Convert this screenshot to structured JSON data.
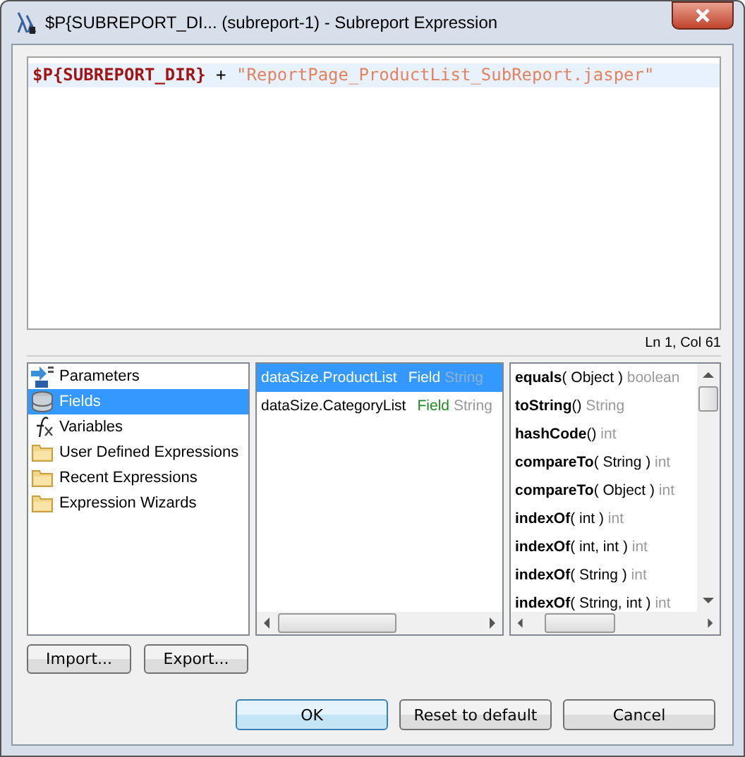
{
  "window": {
    "title": "$P{SUBREPORT_DI... (subreport-1) - Subreport Expression"
  },
  "editor": {
    "tokens": [
      {
        "kind": "param",
        "text": "$P{SUBREPORT_DIR}"
      },
      {
        "kind": "op",
        "text": " + "
      },
      {
        "kind": "string",
        "text": "\"ReportPage_ProductList_SubReport.jasper\""
      }
    ],
    "position": "Ln 1, Col 61"
  },
  "categories": [
    {
      "kind": "parameters",
      "label": "Parameters",
      "selected": false
    },
    {
      "kind": "fields",
      "label": "Fields",
      "selected": true
    },
    {
      "kind": "variables",
      "label": "Variables",
      "selected": false
    },
    {
      "kind": "folder",
      "label": "User Defined Expressions",
      "selected": false
    },
    {
      "kind": "folder",
      "label": "Recent Expressions",
      "selected": false
    },
    {
      "kind": "folder",
      "label": "Expression Wizards",
      "selected": false
    }
  ],
  "fields": [
    {
      "name": "dataSize.ProductList",
      "kind": "Field",
      "type": "String",
      "selected": true
    },
    {
      "name": "dataSize.CategoryList",
      "kind": "Field",
      "type": "String",
      "selected": false
    }
  ],
  "methods": [
    {
      "name": "equals",
      "args": "( Object )",
      "type": "boolean"
    },
    {
      "name": "toString",
      "args": "()",
      "type": "String"
    },
    {
      "name": "hashCode",
      "args": "()",
      "type": "int"
    },
    {
      "name": "compareTo",
      "args": "( String )",
      "type": "int"
    },
    {
      "name": "compareTo",
      "args": "( Object )",
      "type": "int"
    },
    {
      "name": "indexOf",
      "args": "( int )",
      "type": "int"
    },
    {
      "name": "indexOf",
      "args": "( int, int )",
      "type": "int"
    },
    {
      "name": "indexOf",
      "args": "( String )",
      "type": "int"
    },
    {
      "name": "indexOf",
      "args": "( String, int )",
      "type": "int"
    }
  ],
  "tool_buttons": [
    "Import...",
    "Export..."
  ],
  "buttons": [
    {
      "label": "OK",
      "default": true
    },
    {
      "label": "Reset to default",
      "default": false
    },
    {
      "label": "Cancel",
      "default": false
    }
  ]
}
